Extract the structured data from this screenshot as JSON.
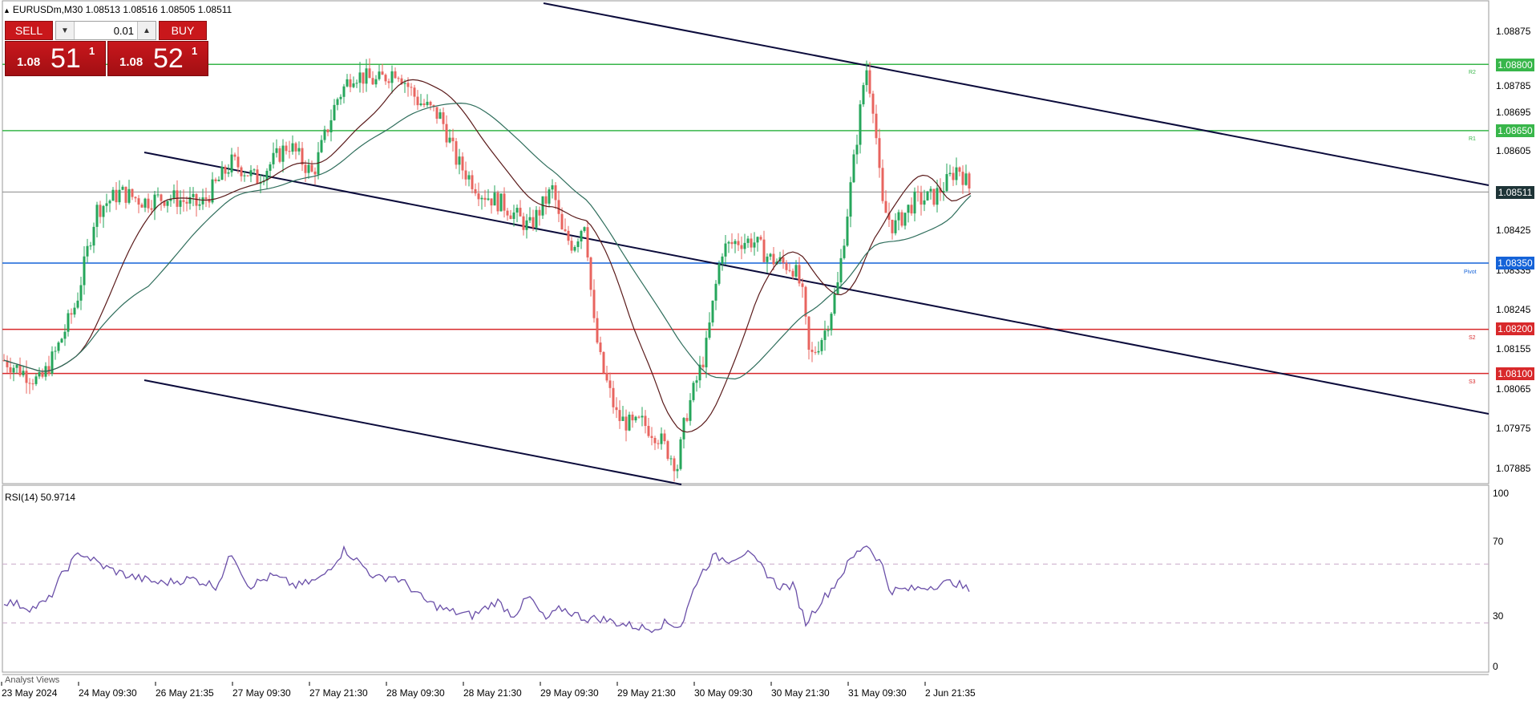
{
  "header": {
    "symbol_line": "EURUSDm,M30  1.08513 1.08516 1.08505 1.08511"
  },
  "trade_panel": {
    "sell_label": "SELL",
    "buy_label": "BUY",
    "lot_value": "0.01",
    "sell_price_small": "1.08",
    "sell_price_big": "51",
    "sell_price_sup": "1",
    "buy_price_small": "1.08",
    "buy_price_big": "52",
    "buy_price_sup": "1"
  },
  "price_axis": {
    "ticks": [
      "1.08875",
      "1.08785",
      "1.08695",
      "1.08605",
      "1.08425",
      "1.08335",
      "1.08245",
      "1.08155",
      "1.08065",
      "1.07975",
      "1.07885"
    ]
  },
  "levels": {
    "r2": {
      "label": "1.08800",
      "tag": "R2",
      "value": 1.088,
      "color": "#38b64a"
    },
    "r1": {
      "label": "1.08650",
      "tag": "R1",
      "value": 1.0865,
      "color": "#38b64a"
    },
    "current": {
      "label": "1.08511",
      "value": 1.08511,
      "color": "#1e3437"
    },
    "pivot": {
      "label": "1.08350",
      "tag": "Pivot",
      "value": 1.0835,
      "color": "#1563d8"
    },
    "s2": {
      "label": "1.08200",
      "tag": "S2",
      "value": 1.082,
      "color": "#d8292b"
    },
    "s3": {
      "label": "1.08100",
      "tag": "S3",
      "value": 1.081,
      "color": "#d8292b"
    }
  },
  "rsi": {
    "label": "RSI(14) 50.9714",
    "ticks": [
      "100",
      "70",
      "30",
      "0"
    ],
    "levels": [
      70,
      30
    ],
    "color": "#6a4fa8"
  },
  "time_axis": {
    "labels": [
      "23 May 2024",
      "24 May 09:30",
      "26 May 21:35",
      "27 May 09:30",
      "27 May 21:30",
      "28 May 09:30",
      "28 May 21:30",
      "29 May 09:30",
      "29 May 21:30",
      "30 May 09:30",
      "30 May 21:30",
      "31 May 09:30",
      "2 Jun 21:35"
    ]
  },
  "footer": {
    "analyst_views": "Analyst Views"
  },
  "colors": {
    "bull": "#26a65b",
    "bear": "#e8645f",
    "channel": "#0b0b3b",
    "ma1": "#5a1a1a",
    "ma2": "#2f6e5c",
    "ma3": "#7b5a9a"
  }
}
